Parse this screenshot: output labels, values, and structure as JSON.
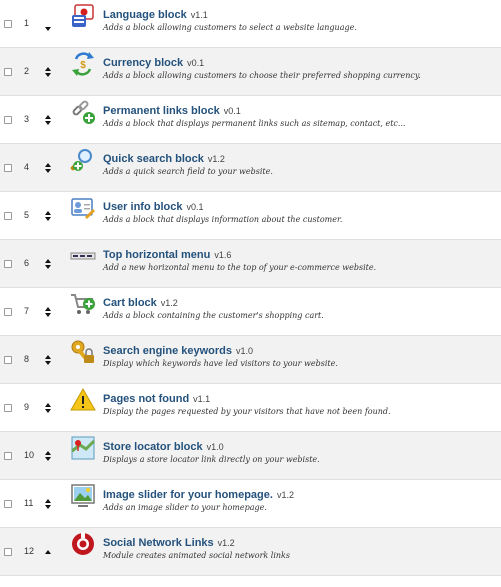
{
  "modules": [
    {
      "position": "1",
      "name": "Language block",
      "version": "v1.1",
      "description": "Adds a block allowing customers to select a website language.",
      "icon": "language-flags-icon",
      "order": "down"
    },
    {
      "position": "2",
      "name": "Currency block",
      "version": "v0.1",
      "description": "Adds a block allowing customers to choose their preferred shopping currency.",
      "icon": "currency-exchange-icon",
      "order": "both"
    },
    {
      "position": "3",
      "name": "Permanent links block",
      "version": "v0.1",
      "description": "Adds a block that displays permanent links such as sitemap, contact, etc...",
      "icon": "chain-link-add-icon",
      "order": "both"
    },
    {
      "position": "4",
      "name": "Quick search block",
      "version": "v1.2",
      "description": "Adds a quick search field to your website.",
      "icon": "magnifier-add-icon",
      "order": "both"
    },
    {
      "position": "5",
      "name": "User info block",
      "version": "v0.1",
      "description": "Adds a block that displays information about the customer.",
      "icon": "user-card-edit-icon",
      "order": "both"
    },
    {
      "position": "6",
      "name": "Top horizontal menu",
      "version": "v1.6",
      "description": "Add a new horizontal menu to the top of your e-commerce website.",
      "icon": "horizontal-menu-icon",
      "order": "both"
    },
    {
      "position": "7",
      "name": "Cart block",
      "version": "v1.2",
      "description": "Adds a block containing the customer's shopping cart.",
      "icon": "shopping-cart-add-icon",
      "order": "both"
    },
    {
      "position": "8",
      "name": "Search engine keywords",
      "version": "v1.0",
      "description": "Display which keywords have led visitors to your website.",
      "icon": "key-lock-icon",
      "order": "both"
    },
    {
      "position": "9",
      "name": "Pages not found",
      "version": "v1.1",
      "description": "Display the pages requested by your visitors that have not been found.",
      "icon": "warning-icon",
      "order": "both"
    },
    {
      "position": "10",
      "name": "Store locator block",
      "version": "v1.0",
      "description": "Displays a store locator link directly on your webiste.",
      "icon": "map-pin-icon",
      "order": "both"
    },
    {
      "position": "11",
      "name": "Image slider for your homepage.",
      "version": "v1.2",
      "description": "Adds an image slider to your homepage.",
      "icon": "image-slider-icon",
      "order": "both"
    },
    {
      "position": "12",
      "name": "Social Network Links",
      "version": "v1.2",
      "description": "Module creates animated social network links",
      "icon": "social-network-icon",
      "order": "up"
    }
  ],
  "colors": {
    "title": "#24527c",
    "row_alt": "#f2f2f2",
    "row": "#ffffff",
    "divider": "#dfdfdf"
  }
}
